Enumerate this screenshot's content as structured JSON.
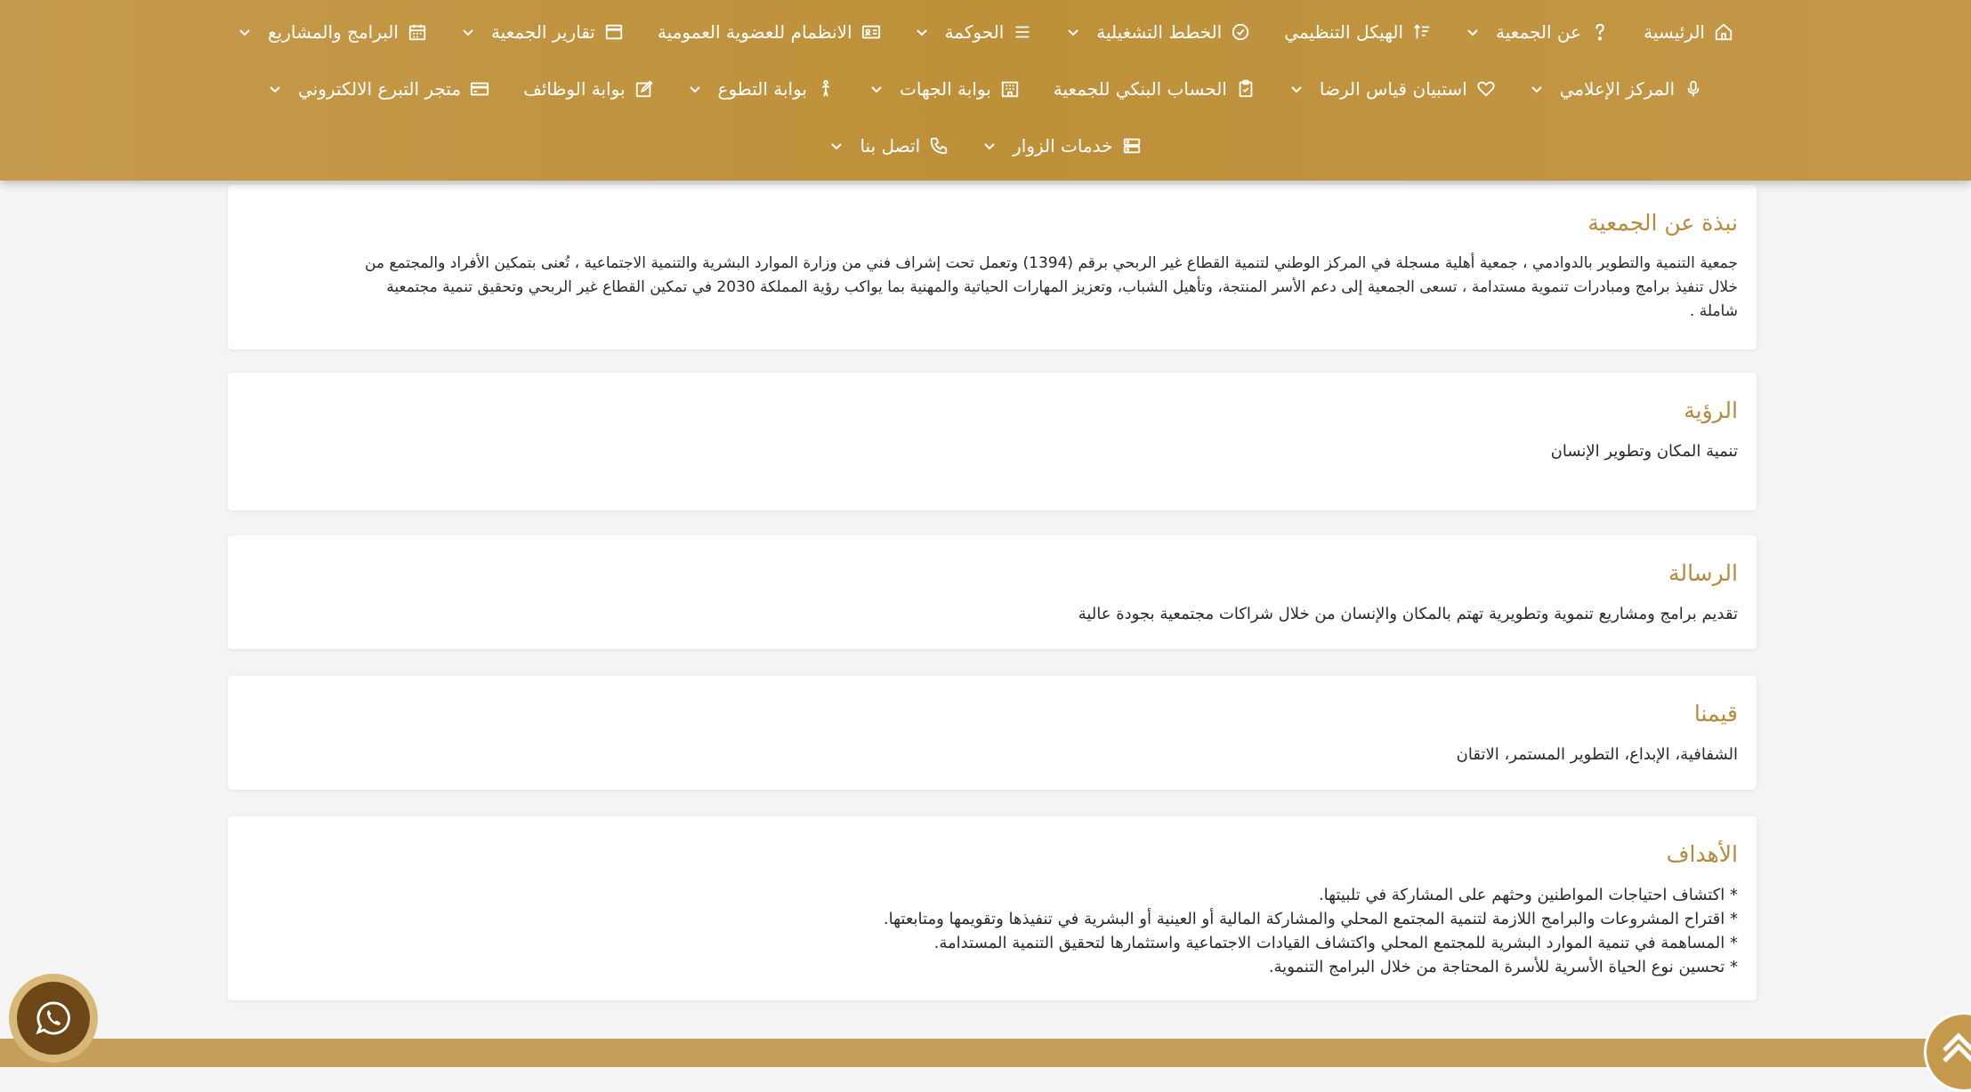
{
  "nav": {
    "row1": [
      {
        "label": "الرئيسية",
        "icon": "home-icon",
        "dropdown": false
      },
      {
        "label": "عن الجمعية",
        "icon": "question-icon",
        "dropdown": true
      },
      {
        "label": "الهيكل التنظيمي",
        "icon": "sort-icon",
        "dropdown": false
      },
      {
        "label": "الخطط التشغيلية",
        "icon": "check-circle-icon",
        "dropdown": true
      },
      {
        "label": "الحوكمة",
        "icon": "list-icon",
        "dropdown": true
      },
      {
        "label": "الانظمام للعضوية العمومية",
        "icon": "id-card-icon",
        "dropdown": false
      },
      {
        "label": "تقارير الجمعية",
        "icon": "window-icon",
        "dropdown": true
      },
      {
        "label": "البرامج والمشاريع",
        "icon": "calendar-icon",
        "dropdown": true
      }
    ],
    "row2": [
      {
        "label": "المركز الإعلامي",
        "icon": "microphone-icon",
        "dropdown": true
      },
      {
        "label": "استبيان قياس الرضا",
        "icon": "heart-icon",
        "dropdown": true
      },
      {
        "label": "الحساب البنكي للجمعية",
        "icon": "clipboard-icon",
        "dropdown": false
      },
      {
        "label": "بوابة الجهات",
        "icon": "building-icon",
        "dropdown": true
      },
      {
        "label": "بوابة التطوع",
        "icon": "person-icon",
        "dropdown": true
      },
      {
        "label": "بوابة الوظائف",
        "icon": "edit-icon",
        "dropdown": false
      },
      {
        "label": "متجر التبرع الالكتروني",
        "icon": "credit-card-icon",
        "dropdown": true
      }
    ],
    "row3": [
      {
        "label": "خدمات الزوار",
        "icon": "server-icon",
        "dropdown": true
      },
      {
        "label": "اتصل بنا",
        "icon": "phone-icon",
        "dropdown": true
      }
    ]
  },
  "sections": {
    "about": {
      "title": "نبذة عن الجمعية",
      "line1": "جمعية التنمية والتطوير بالدوادمي ، جمعية أهلية مسجلة في المركز الوطني لتنمية القطاع غير الربحي برقم (1394) وتعمل تحت إشراف فني من وزارة الموارد البشرية والتنمية الاجتماعية ، تُعنى بتمكين الأفراد والمجتمع من",
      "line2": "خلال تنفيذ برامج ومبادرات تنموية مستدامة ، تسعى الجمعية إلى دعم الأسر المنتجة، وتأهيل الشباب، وتعزيز المهارات الحياتية والمهنية بما يواكب رؤية المملكة 2030 في تمكين القطاع غير الربحي وتحقيق تنمية مجتمعية",
      "line3": "شاملة ."
    },
    "vision": {
      "title": "الرؤية",
      "text": "تنمية المكان وتطوير الإنسان"
    },
    "mission": {
      "title": "الرسالة",
      "text": "تقديم برامج ومشاريع تنموية وتطويرية تهتم بالمكان والإنسان من خلال شراكات مجتمعية بجودة عالية"
    },
    "values": {
      "title": "قيمنا",
      "text": "الشفافية، الإبداع، التطوير المستمر، الاتقان"
    },
    "goals": {
      "title": "الأهداف",
      "items": [
        "* اكتشاف احتياجات المواطنين وحثهم على المشاركة في تلبيتها.",
        "* اقتراح المشروعات والبرامج اللازمة لتنمية المجتمع المحلي والمشاركة المالية أو العينية أو البشرية في تنفيذها وتقويمها ومتابعتها.",
        "* المساهمة في تنمية الموارد البشرية للمجتمع المحلي واكتشاف القيادات الاجتماعية واستثمارها لتحقيق التنمية المستدامة.",
        "* تحسين نوع الحياة الأسرية للأسرة المحتاجة من خلال البرامج التنموية."
      ]
    }
  },
  "widgets": {
    "whatsapp_icon": "whatsapp-icon",
    "scroll_top_icon": "chevron-up-icon"
  },
  "colors": {
    "nav_bg": "#c69a4c",
    "heading": "#b68a3e",
    "footer": "#c6a05b",
    "whatsapp_inner": "#6e4719"
  }
}
